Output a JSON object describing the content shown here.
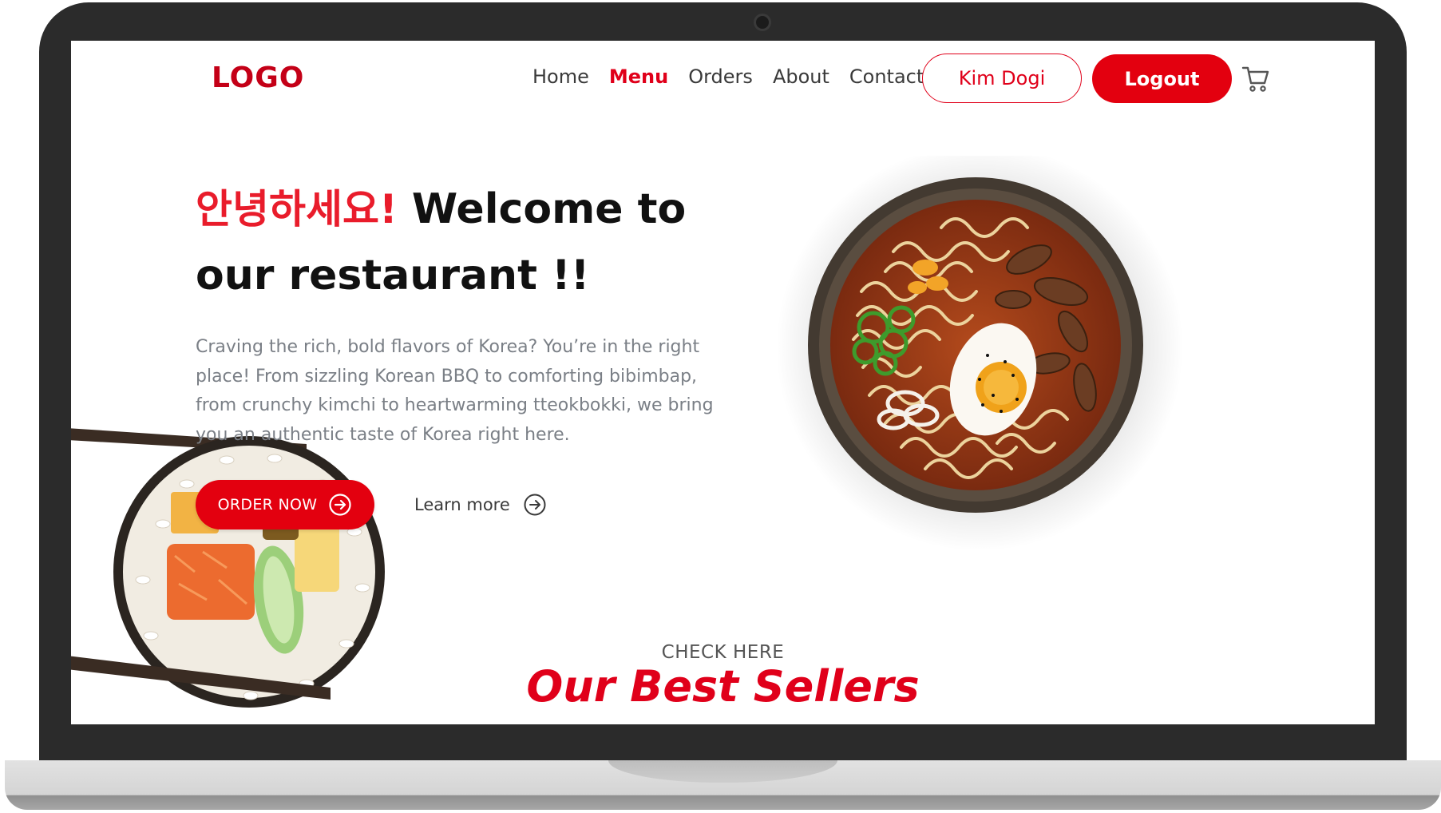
{
  "header": {
    "logo": "LOGO",
    "nav": [
      "Home",
      "Menu",
      "Orders",
      "About",
      "Contact"
    ],
    "active_nav": "Menu",
    "user_button": "Kim Dogi",
    "logout_button": "Logout",
    "cart_icon": "shopping-cart-icon"
  },
  "hero": {
    "greeting": "안녕하세요!",
    "title_rest": "Welcome to our restaurant !!",
    "description": "Craving the rich, bold flavors of Korea? You’re in the right place! From sizzling Korean BBQ to comforting bibimbap, from crunchy kimchi to heartwarming tteokbokki, we bring you an authentic taste of Korea right here.",
    "order_button": "ORDER NOW",
    "learn_more": "Learn more"
  },
  "section": {
    "eyebrow": "CHECK HERE",
    "title": "Our Best Sellers"
  },
  "colors": {
    "accent": "#e3000f",
    "bezel": "#2b2b2b"
  }
}
